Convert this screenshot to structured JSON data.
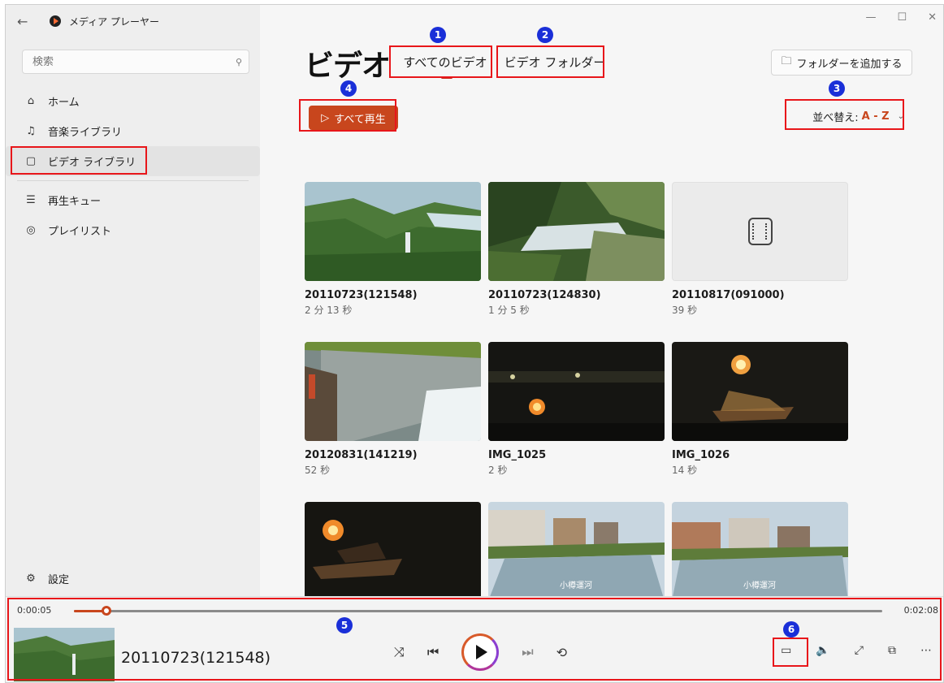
{
  "app": {
    "title": "メディア プレーヤー",
    "back_glyph": "←",
    "window_controls": [
      "—",
      "☐",
      "✕"
    ]
  },
  "search": {
    "placeholder": "検索",
    "icon": "search-icon"
  },
  "sidebar": {
    "items": [
      {
        "label": "ホーム",
        "icon": "home-icon",
        "glyph": "⌂",
        "active": false
      },
      {
        "label": "音楽ライブラリ",
        "icon": "music-note-icon",
        "glyph": "♫",
        "active": false
      },
      {
        "label": "ビデオ ライブラリ",
        "icon": "film-icon",
        "glyph": "▢",
        "active": true
      },
      {
        "label": "再生キュー",
        "icon": "queue-icon",
        "glyph": "☰",
        "active": false
      },
      {
        "label": "プレイリスト",
        "icon": "playlist-icon",
        "glyph": "◎",
        "active": false
      }
    ],
    "settings": {
      "label": "設定",
      "icon": "gear-icon",
      "glyph": "⚙"
    }
  },
  "main": {
    "title": "ビデオ",
    "tabs": [
      {
        "label": "すべてのビデオ",
        "selected": true
      },
      {
        "label": "ビデオ フォルダー",
        "selected": false
      }
    ],
    "add_folder_label": "フォルダーを追加する",
    "play_all_label": "すべて再生",
    "sort_prefix": "並べ替え:",
    "sort_value": "A - Z",
    "accent_color": "#c8461d"
  },
  "videos": [
    {
      "title": "20110723(121548)",
      "duration": "2 分 13 秒",
      "thumb": "mountain-waterfall"
    },
    {
      "title": "20110723(124830)",
      "duration": "1 分 5 秒",
      "thumb": "waterfall-closeup"
    },
    {
      "title": "20110817(091000)",
      "duration": "39 秒",
      "thumb": "placeholder"
    },
    {
      "title": "20120831(141219)",
      "duration": "52 秒",
      "thumb": "dam"
    },
    {
      "title": "IMG_1025",
      "duration": "2 秒",
      "thumb": "night-fire"
    },
    {
      "title": "IMG_1026",
      "duration": "14 秒",
      "thumb": "night-boat"
    },
    {
      "title": "",
      "duration": "",
      "thumb": "night-boat-2"
    },
    {
      "title": "",
      "duration": "",
      "thumb": "canal",
      "caption": "小樽運河"
    },
    {
      "title": "",
      "duration": "",
      "thumb": "canal-2",
      "caption": "小樽運河"
    }
  ],
  "annotations": [
    "1",
    "2",
    "3",
    "4",
    "5",
    "6"
  ],
  "player": {
    "elapsed": "0:00:05",
    "total": "0:02:08",
    "progress": 0.04,
    "now_playing": "20110723(121548)",
    "buttons": [
      "shuffle-icon",
      "previous-icon",
      "play-icon",
      "next-icon",
      "repeat-icon",
      "captions-icon",
      "volume-icon",
      "fullscreen-icon",
      "miniplayer-icon",
      "more-icon"
    ]
  }
}
